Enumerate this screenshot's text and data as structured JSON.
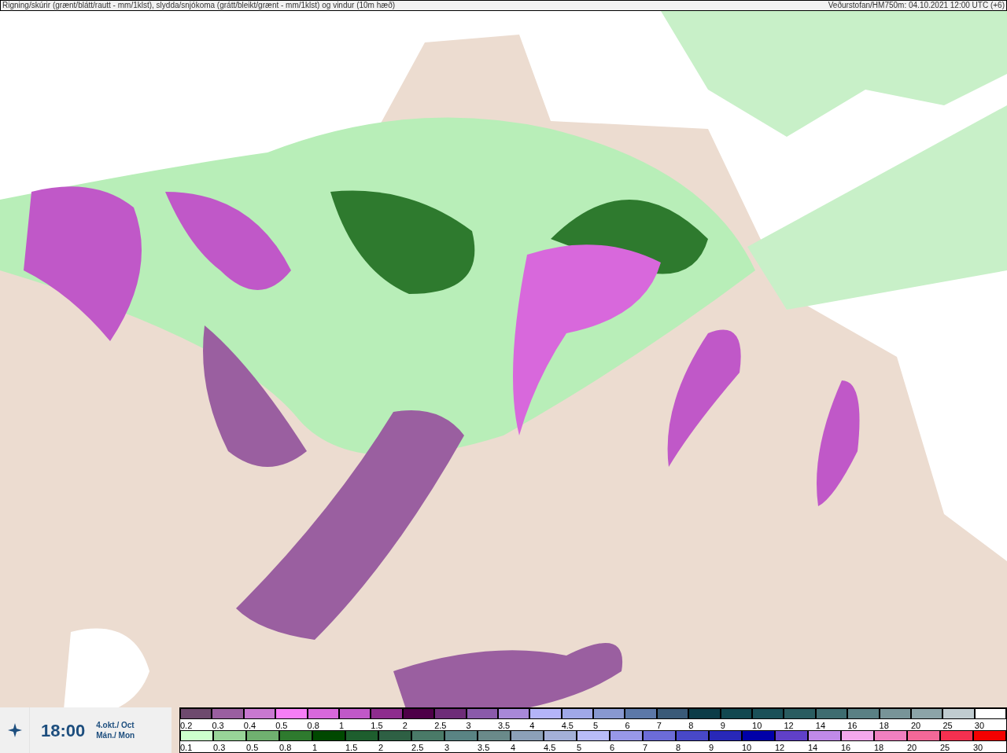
{
  "header": {
    "title": "Rigning/skúrir (grænt/blátt/rautt - mm/1klst), slydda/snjókoma (grátt/bleikt/grænt - mm/1klst) og vindur (10m hæð)",
    "source": "Veðurstofan/HM750m: 04.10.2021 12:00 UTC (+6)"
  },
  "time_panel": {
    "time": "18:00",
    "date": "4.okt./ Oct",
    "weekday": "Mán./ Mon"
  },
  "legends": [
    {
      "steps": [
        {
          "label": "0.2",
          "color": "#6e4a6e"
        },
        {
          "label": "0.3",
          "color": "#9a5fa0"
        },
        {
          "label": "0.4",
          "color": "#c878d0"
        },
        {
          "label": "0.5",
          "color": "#f67ef6"
        },
        {
          "label": "0.8",
          "color": "#d868dc"
        },
        {
          "label": "1",
          "color": "#c058c8"
        },
        {
          "label": "1.5",
          "color": "#8e2c8e"
        },
        {
          "label": "2",
          "color": "#4e0048"
        },
        {
          "label": "2.5",
          "color": "#6e2c78"
        },
        {
          "label": "3",
          "color": "#8a5aaa"
        },
        {
          "label": "3.5",
          "color": "#a888d8"
        },
        {
          "label": "4",
          "color": "#b4b4f8"
        },
        {
          "label": "4.5",
          "color": "#a0a8e8"
        },
        {
          "label": "5",
          "color": "#8898d0"
        },
        {
          "label": "6",
          "color": "#5c78a8"
        },
        {
          "label": "7",
          "color": "#3a5a78"
        },
        {
          "label": "8",
          "color": "#0c3c48"
        },
        {
          "label": "9",
          "color": "#124850"
        },
        {
          "label": "10",
          "color": "#1a5058"
        },
        {
          "label": "12",
          "color": "#2a5c60"
        },
        {
          "label": "14",
          "color": "#3e6c70"
        },
        {
          "label": "16",
          "color": "#5a8084"
        },
        {
          "label": "18",
          "color": "#789498"
        },
        {
          "label": "20",
          "color": "#8ca4a8"
        },
        {
          "label": "25",
          "color": "#c0ccd0"
        },
        {
          "label": "30",
          "color": "#ffffff"
        }
      ]
    },
    {
      "steps": [
        {
          "label": "0.1",
          "color": "#ccffcc"
        },
        {
          "label": "0.3",
          "color": "#98d498"
        },
        {
          "label": "0.5",
          "color": "#70b070"
        },
        {
          "label": "0.8",
          "color": "#2e7a2e"
        },
        {
          "label": "1",
          "color": "#004800"
        },
        {
          "label": "1.5",
          "color": "#1e5e2e"
        },
        {
          "label": "2",
          "color": "#2e6044"
        },
        {
          "label": "2.5",
          "color": "#4a7a68"
        },
        {
          "label": "3",
          "color": "#5a8484"
        },
        {
          "label": "3.5",
          "color": "#6a8a8a"
        },
        {
          "label": "4",
          "color": "#8ca0b8"
        },
        {
          "label": "4.5",
          "color": "#a4b0d8"
        },
        {
          "label": "5",
          "color": "#b8bcf8"
        },
        {
          "label": "6",
          "color": "#9898e8"
        },
        {
          "label": "7",
          "color": "#6c6cd8"
        },
        {
          "label": "8",
          "color": "#4848c8"
        },
        {
          "label": "9",
          "color": "#2828b8"
        },
        {
          "label": "10",
          "color": "#0000a8"
        },
        {
          "label": "12",
          "color": "#6040c8"
        },
        {
          "label": "14",
          "color": "#c08ae8"
        },
        {
          "label": "16",
          "color": "#f4a8ec"
        },
        {
          "label": "18",
          "color": "#f080c0"
        },
        {
          "label": "20",
          "color": "#f46898"
        },
        {
          "label": "25",
          "color": "#f43050"
        },
        {
          "label": "30",
          "color": "#f40000"
        }
      ]
    }
  ]
}
